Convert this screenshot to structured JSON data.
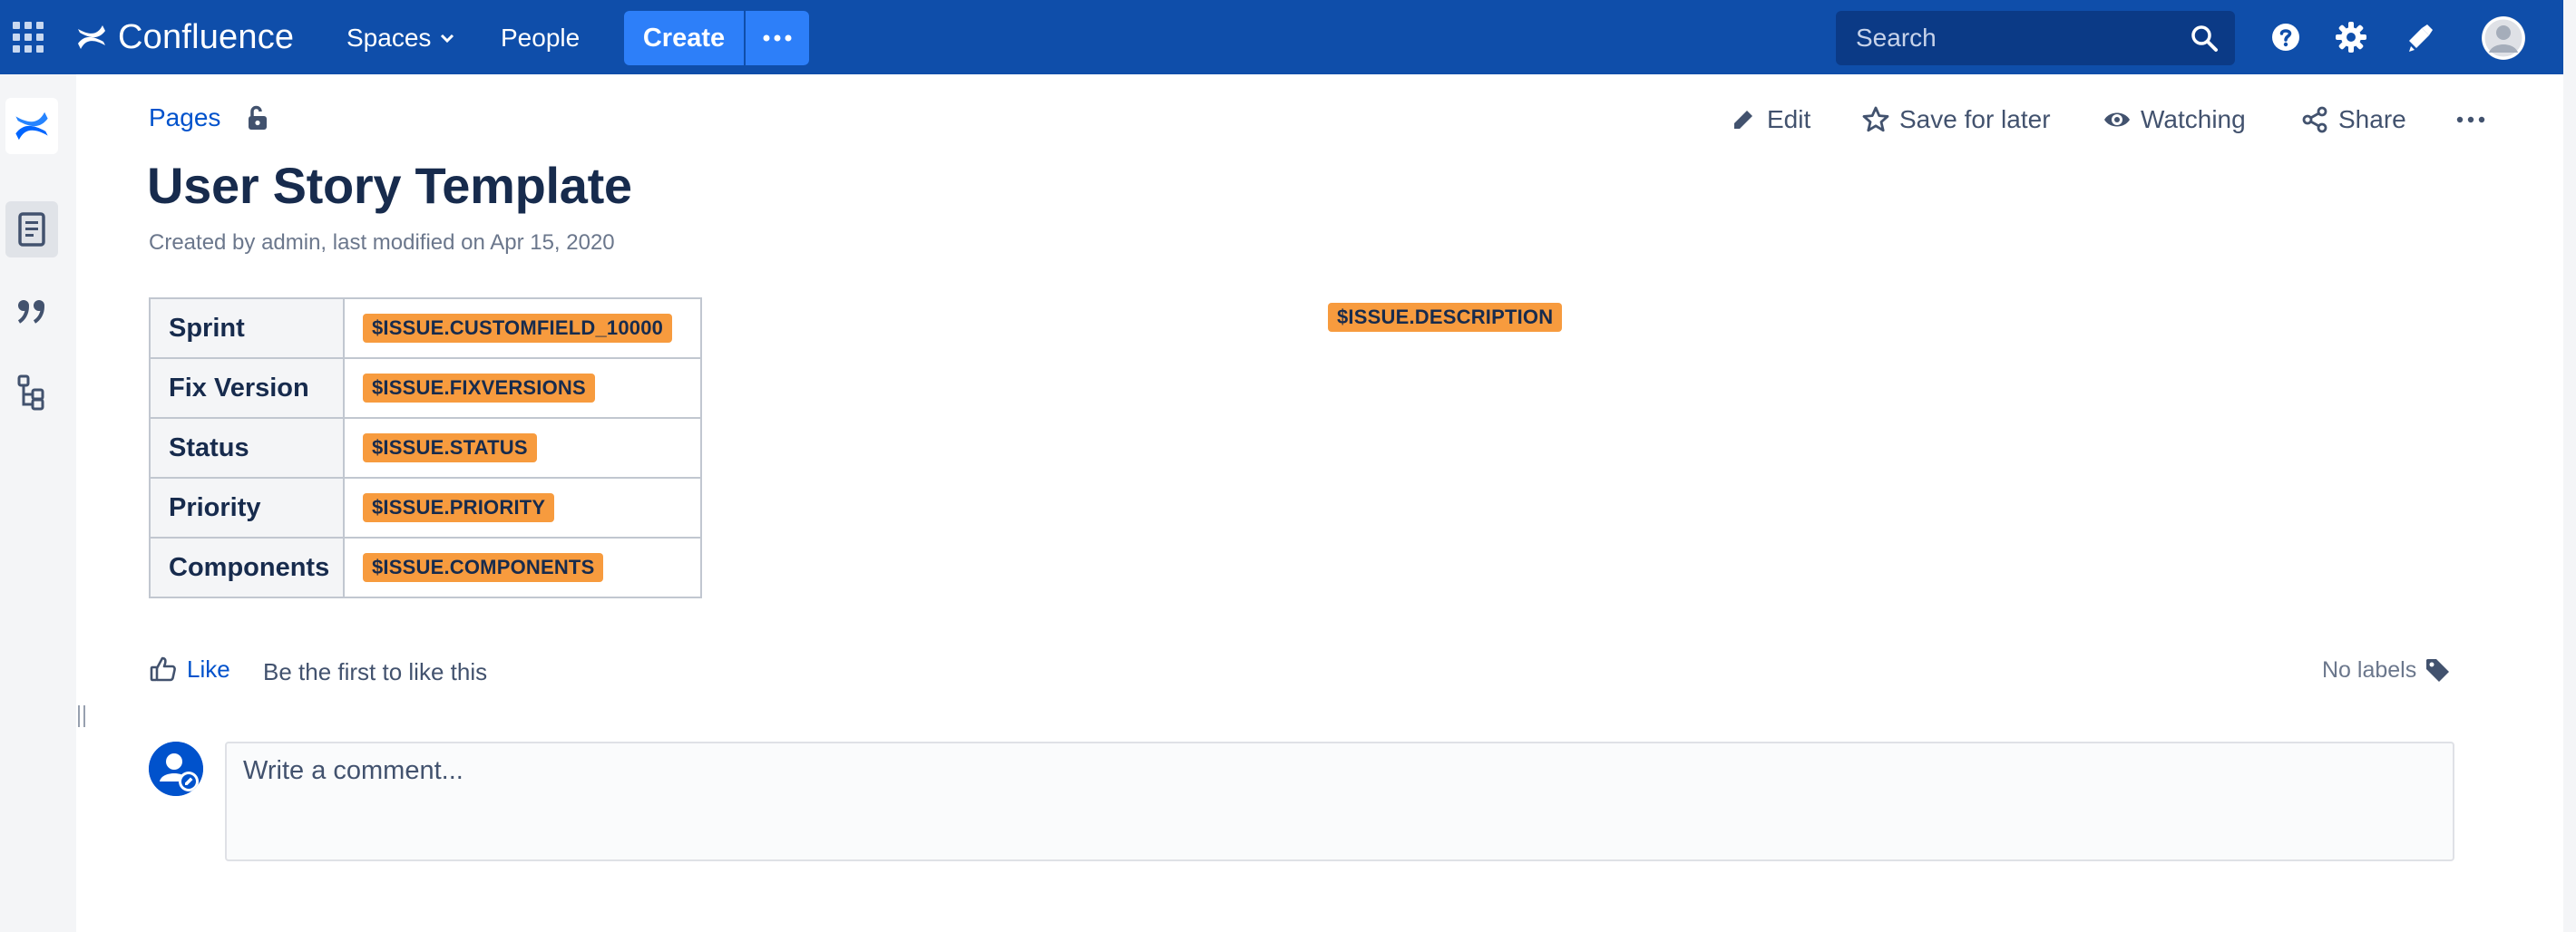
{
  "app": {
    "name": "Confluence",
    "colors": {
      "nav": "#0f4eaa",
      "create": "#2d7ff9",
      "link": "#0052cc",
      "macro": "#f79b3e"
    }
  },
  "nav": {
    "spaces_label": "Spaces",
    "people_label": "People",
    "create_label": "Create",
    "search_placeholder": "Search"
  },
  "sidebar": {
    "icons": [
      "confluence-logo-icon",
      "pages-icon",
      "blog-quote-icon",
      "page-tree-icon"
    ]
  },
  "page": {
    "breadcrumb": "Pages",
    "title": "User Story Template",
    "byline": "Created by admin, last modified on Apr 15, 2020",
    "actions": {
      "edit": "Edit",
      "save_for_later": "Save for later",
      "watching": "Watching",
      "share": "Share"
    }
  },
  "details": {
    "rows": [
      {
        "key": "Sprint",
        "value": "$ISSUE.CUSTOMFIELD_10000"
      },
      {
        "key": "Fix Version",
        "value": "$ISSUE.FIXVERSIONS"
      },
      {
        "key": "Status",
        "value": "$ISSUE.STATUS"
      },
      {
        "key": "Priority",
        "value": "$ISSUE.PRIORITY"
      },
      {
        "key": "Components",
        "value": "$ISSUE.COMPONENTS"
      }
    ],
    "description": "$ISSUE.DESCRIPTION"
  },
  "footer": {
    "like_label": "Like",
    "like_text": "Be the first to like this",
    "labels_text": "No labels"
  },
  "comment": {
    "placeholder": "Write a comment..."
  }
}
